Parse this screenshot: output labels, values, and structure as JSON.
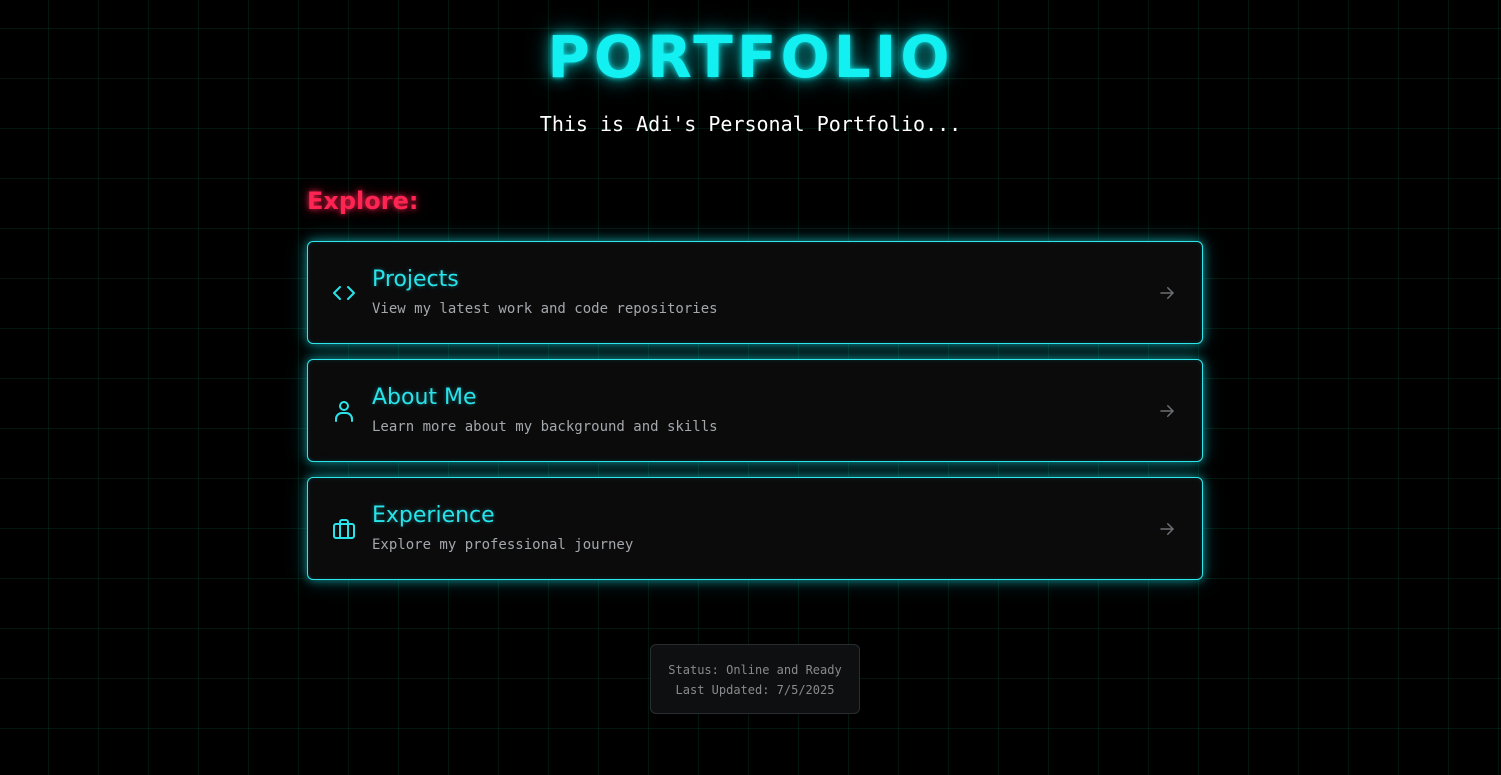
{
  "header": {
    "title": "PORTFOLIO",
    "subtitle": "This is Adi's Personal Portfolio..."
  },
  "explore": {
    "heading": "Explore:"
  },
  "nav_cards": [
    {
      "title": "Projects",
      "description": "View my latest work and code repositories",
      "icon": "code-icon"
    },
    {
      "title": "About Me",
      "description": "Learn more about my background and skills",
      "icon": "user-icon"
    },
    {
      "title": "Experience",
      "description": "Explore my professional journey",
      "icon": "briefcase-icon"
    }
  ],
  "status": {
    "line1": "Status: Online and Ready",
    "line2": "Last Updated: 7/5/2025"
  },
  "colors": {
    "accent_cyan": "#12f0f2",
    "accent_pink": "#ff2452",
    "background": "#000000"
  }
}
